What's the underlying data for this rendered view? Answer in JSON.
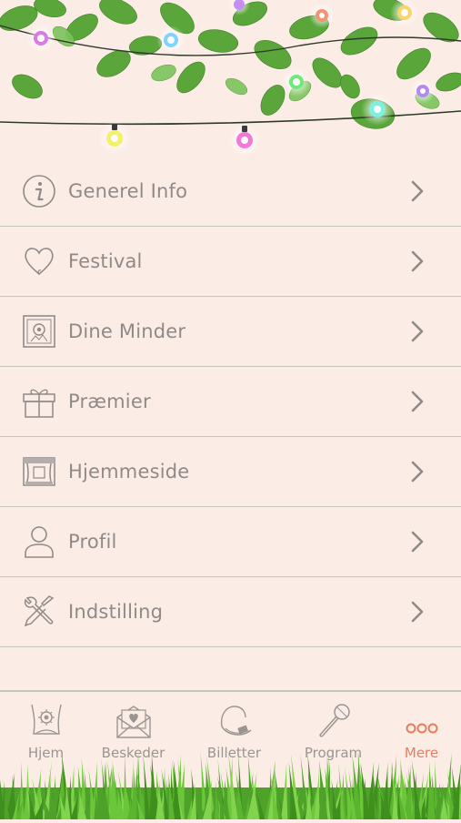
{
  "menu": {
    "items": [
      {
        "label": "Generel Info",
        "icon": "info-icon"
      },
      {
        "label": "Festival",
        "icon": "heart-icon"
      },
      {
        "label": "Dine Minder",
        "icon": "memories-photo-icon"
      },
      {
        "label": "Præmier",
        "icon": "gift-icon"
      },
      {
        "label": "Hjemmeside",
        "icon": "stage-website-icon"
      },
      {
        "label": "Profil",
        "icon": "person-icon"
      },
      {
        "label": "Indstilling",
        "icon": "wrench-screwdriver-icon"
      }
    ]
  },
  "tabbar": {
    "tabs": [
      {
        "label": "Hjem",
        "icon": "home-tent-icon",
        "active": false
      },
      {
        "label": "Beskeder",
        "icon": "envelope-icon",
        "active": false
      },
      {
        "label": "Billetter",
        "icon": "wristband-icon",
        "active": false
      },
      {
        "label": "Program",
        "icon": "microphone-icon",
        "active": false
      },
      {
        "label": "Mere",
        "icon": "more-dots-icon",
        "active": true
      }
    ]
  },
  "colors": {
    "background": "#fcece6",
    "text": "#8f8a88",
    "accent": "#ec7b5c",
    "divider": "#c9c3c0"
  }
}
